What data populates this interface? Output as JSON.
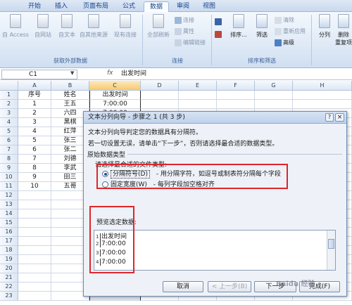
{
  "ribbon_tabs": [
    "开始",
    "插入",
    "页面布局",
    "公式",
    "数据",
    "审阅",
    "视图"
  ],
  "active_tab": "数据",
  "groups": {
    "external_data": {
      "label": "获取外部数据",
      "buttons": [
        "自 Access",
        "自网站",
        "自文本",
        "自其他来源",
        "现有连接"
      ]
    },
    "connections": {
      "label": "连接",
      "refresh_all": "全部刷新",
      "items": [
        "连接",
        "属性",
        "编辑链接"
      ]
    },
    "sort_filter": {
      "label": "排序和筛选",
      "sort": "排序...",
      "filter": "筛选",
      "items": [
        "清除",
        "重新应用",
        "高级"
      ]
    },
    "tools": {
      "split": "分列",
      "remove": "删除",
      "remove2": "重复项"
    }
  },
  "formula_bar": {
    "name_box": "C1",
    "fx": "fx",
    "formula": "出发时间"
  },
  "columns": [
    "A",
    "B",
    "C",
    "D",
    "E",
    "F",
    "G",
    "H"
  ],
  "rows": [
    "1",
    "2",
    "3",
    "4",
    "5",
    "6",
    "7",
    "8",
    "9",
    "10",
    "11",
    "12",
    "13",
    "14",
    "15",
    "16",
    "17",
    "18",
    "19",
    "20",
    "21",
    "22",
    "23"
  ],
  "table": [
    [
      "序号",
      "姓名",
      "出发时间"
    ],
    [
      "1",
      "王五",
      "7:00:00"
    ],
    [
      "2",
      "六四",
      "7:00:00"
    ],
    [
      "3",
      "黑棋",
      ""
    ],
    [
      "4",
      "红萍",
      ""
    ],
    [
      "5",
      "张三",
      ""
    ],
    [
      "6",
      "张二",
      ""
    ],
    [
      "7",
      "刘德",
      ""
    ],
    [
      "8",
      "李武",
      ""
    ],
    [
      "9",
      "田三",
      ""
    ],
    [
      "10",
      "五哥",
      ""
    ]
  ],
  "dialog": {
    "title": "文本分列向导 - 步骤之 1 (共 3 步)",
    "help": "?",
    "close": "×",
    "line1": "文本分列向导判定您的数据具有分隔符。",
    "line2": "若一切设置无误，请单击“下一步”，否则请选择最合适的数据类型。",
    "section": "原始数据类型",
    "section_sub": "请选择最合适的文件类型:",
    "options": [
      {
        "label": "分隔符号(D)",
        "desc": "- 用分隔字符，如逗号或制表符分隔每个字段",
        "checked": true
      },
      {
        "label": "固定宽度(W)",
        "desc": "- 每列字段加空格对齐",
        "checked": false
      }
    ],
    "preview_label": "预览选定数据:",
    "preview_lines": [
      {
        "n": "1",
        "text": "出发时间"
      },
      {
        "n": "2",
        "text": "7:00:00"
      },
      {
        "n": "3",
        "text": "7:00:00"
      },
      {
        "n": "4",
        "text": "7:00:00"
      }
    ],
    "buttons": {
      "cancel": "取消",
      "back": "< 上一步(B)",
      "next": "下一步",
      "finish": "完成(F)"
    }
  },
  "watermark": "Baidu 经验",
  "colors": {
    "highlight_red": "#e0262a",
    "ribbon_blue": "#dbe7f5",
    "selected_header": "#f8c96c"
  }
}
